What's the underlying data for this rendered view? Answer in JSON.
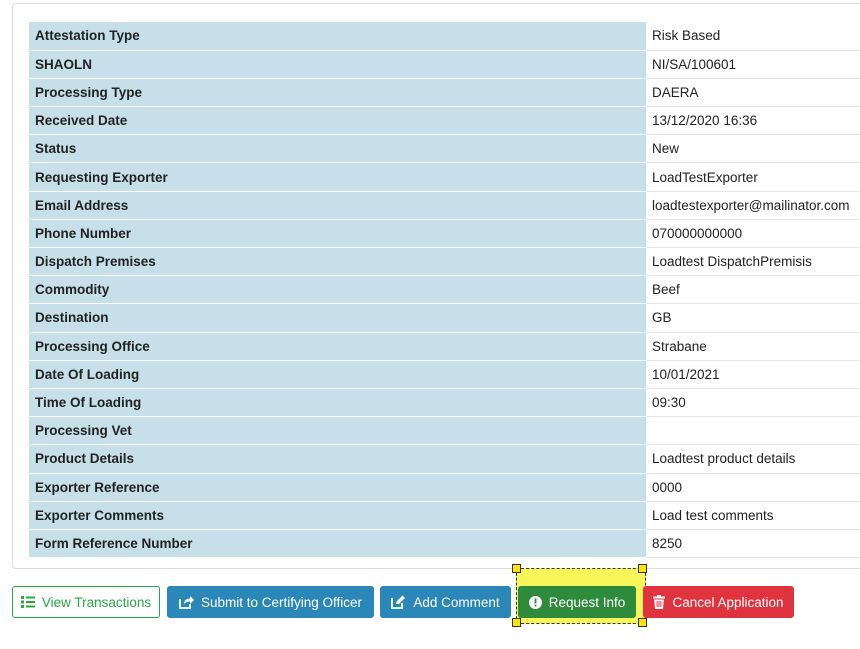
{
  "details": [
    {
      "label": "Attestation Type",
      "value": "Risk Based"
    },
    {
      "label": "SHAOLN",
      "value": "NI/SA/100601"
    },
    {
      "label": "Processing Type",
      "value": "DAERA"
    },
    {
      "label": "Received Date",
      "value": "13/12/2020 16:36"
    },
    {
      "label": "Status",
      "value": "New"
    },
    {
      "label": "Requesting Exporter",
      "value": "LoadTestExporter"
    },
    {
      "label": "Email Address",
      "value": "loadtestexporter@mailinator.com"
    },
    {
      "label": "Phone Number",
      "value": "070000000000"
    },
    {
      "label": "Dispatch Premises",
      "value": "Loadtest DispatchPremisis"
    },
    {
      "label": "Commodity",
      "value": "Beef"
    },
    {
      "label": "Destination",
      "value": "GB"
    },
    {
      "label": "Processing Office",
      "value": "Strabane"
    },
    {
      "label": "Date Of Loading",
      "value": "10/01/2021"
    },
    {
      "label": "Time Of Loading",
      "value": "09:30"
    },
    {
      "label": "Processing Vet",
      "value": ""
    },
    {
      "label": "Product Details",
      "value": "Loadtest  product details"
    },
    {
      "label": "Exporter Reference",
      "value": "0000"
    },
    {
      "label": "Exporter Comments",
      "value": "Load test comments"
    },
    {
      "label": "Form Reference Number",
      "value": "8250"
    }
  ],
  "actions": {
    "view_transactions": "View Transactions",
    "submit_to_certifying_officer": "Submit to Certifying Officer",
    "add_comment": "Add Comment",
    "request_info": "Request Info",
    "cancel_application": "Cancel Application"
  },
  "icons": {
    "view_transactions": "list-icon",
    "submit_to_certifying_officer": "share-icon",
    "add_comment": "edit-icon",
    "request_info": "info-circle-icon",
    "cancel_application": "trash-icon"
  },
  "colors": {
    "label_bg": "#c6dfe8",
    "success": "#28a745",
    "primary": "#2a87b8",
    "request_green": "#2e8b3c",
    "danger": "#e0323f",
    "highlight": "#f8f55a"
  }
}
